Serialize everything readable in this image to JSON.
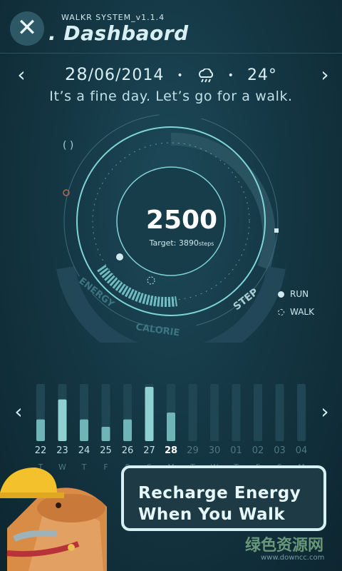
{
  "header": {
    "system_label": "WALKR SYSTEM_v1.1.4",
    "title": ". Dashbaord",
    "close_icon": "close-x-icon"
  },
  "date_bar": {
    "day": "28",
    "rest": "/06/2014",
    "separator": "•",
    "weather_icon": "cloud-rain-icon",
    "temperature": "24°",
    "message": "It’s a fine day.  Let’s go for a walk."
  },
  "gauge": {
    "steps": "2500",
    "target_label": "Target: 3890",
    "target_unit": "steps",
    "segments": [
      "ENERGY",
      "CALORIE",
      "STEP"
    ],
    "progress_fraction": 0.64
  },
  "legend": {
    "run": "RUN",
    "walk": "WALK"
  },
  "week_chart": {
    "days": [
      {
        "num": "22",
        "ltr": "T",
        "value": 0.38,
        "active": true
      },
      {
        "num": "23",
        "ltr": "W",
        "value": 0.73,
        "active": true
      },
      {
        "num": "24",
        "ltr": "T",
        "value": 0.38,
        "active": true
      },
      {
        "num": "25",
        "ltr": "F",
        "value": 0.25,
        "active": true
      },
      {
        "num": "26",
        "ltr": "S",
        "value": 0.38,
        "active": true
      },
      {
        "num": "27",
        "ltr": "S",
        "value": 0.95,
        "active": true
      },
      {
        "num": "28",
        "ltr": "M",
        "value": 0.5,
        "active": true,
        "current": true
      },
      {
        "num": "29",
        "ltr": "T",
        "value": 0,
        "active": false
      },
      {
        "num": "30",
        "ltr": "W",
        "value": 0,
        "active": false
      },
      {
        "num": "01",
        "ltr": "T",
        "value": 0,
        "active": false
      },
      {
        "num": "02",
        "ltr": "F",
        "value": 0,
        "active": false
      },
      {
        "num": "03",
        "ltr": "S",
        "value": 0,
        "active": false
      },
      {
        "num": "04",
        "ltr": "M",
        "value": 0,
        "active": false
      }
    ]
  },
  "callout": {
    "line1": "Recharge Energy",
    "line2": "When You Walk"
  },
  "watermark": {
    "cn": "绿色资源网",
    "url": "www.downcc.com"
  },
  "colors": {
    "accent": "#7fd4d6",
    "bar_active": "#6fb5b8",
    "bar_empty": "#1f4652"
  }
}
